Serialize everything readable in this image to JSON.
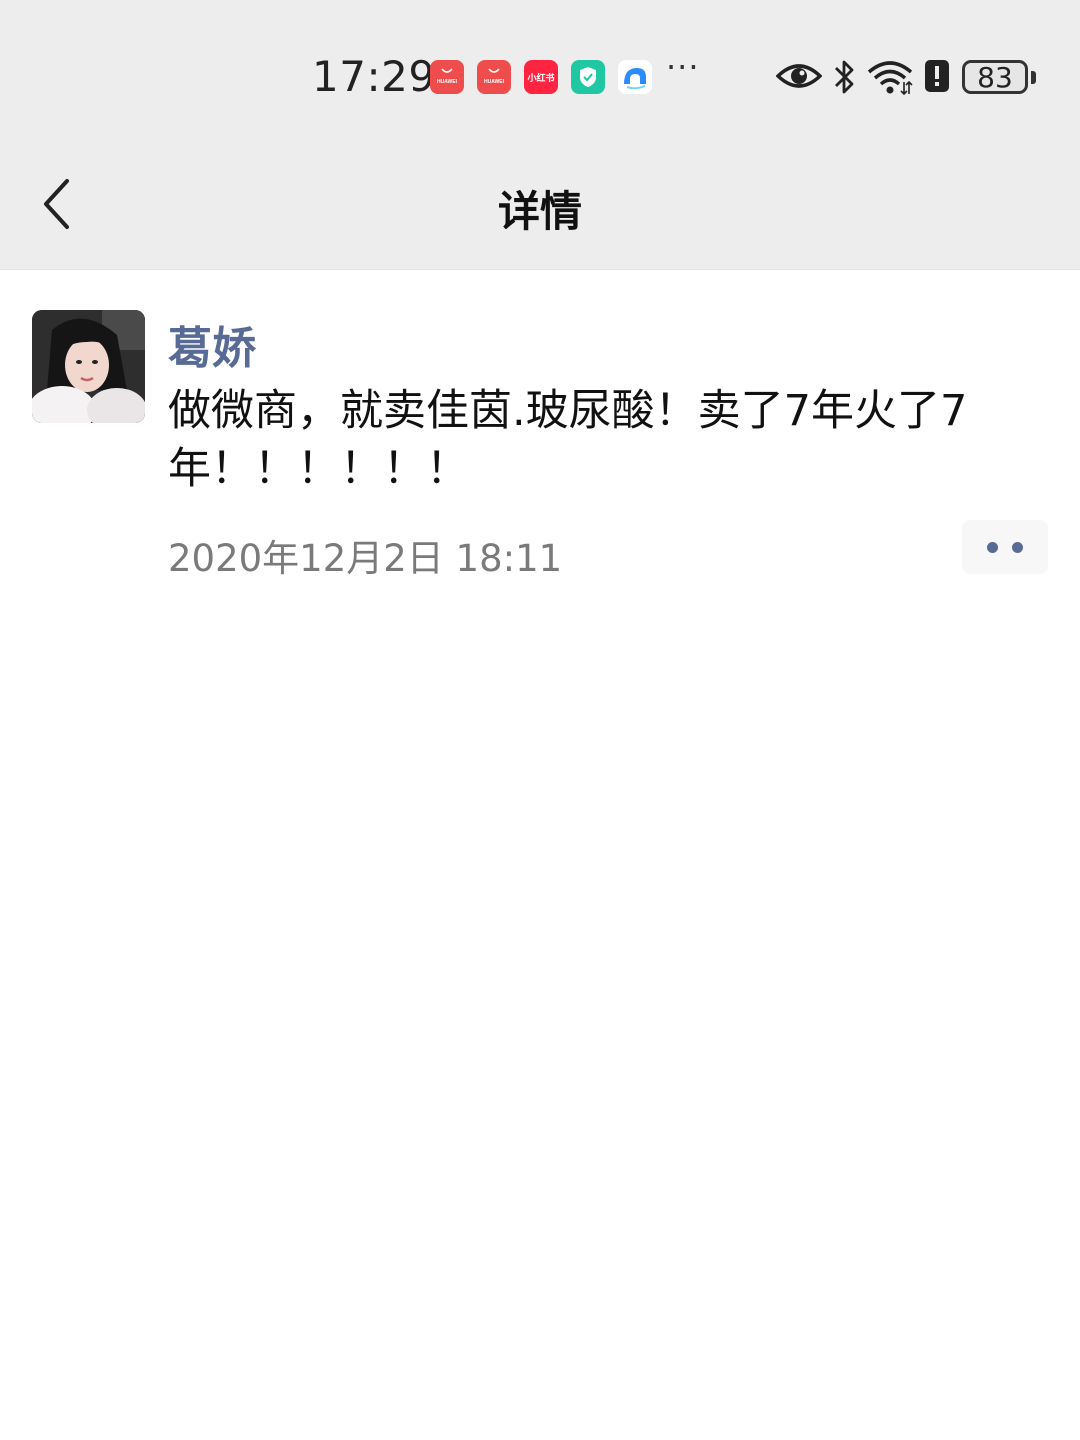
{
  "status_bar": {
    "time": "17:29",
    "app_icons": [
      {
        "name": "huawei-appgallery-icon",
        "label": "HUAWEI",
        "color": "#ef4d4d"
      },
      {
        "name": "huawei-appgallery-icon",
        "label": "HUAWEI",
        "color": "#ef4d4d"
      },
      {
        "name": "xiaohongshu-icon",
        "label": "小红书",
        "color": "#ff2442"
      },
      {
        "name": "security-shield-icon",
        "color": "#1fc7a3"
      },
      {
        "name": "browser-icon",
        "color": "#2b8cff"
      }
    ],
    "more": "···",
    "battery_level": "83"
  },
  "nav": {
    "title": "详情",
    "back_icon": "chevron-left-icon"
  },
  "post": {
    "author": "葛娇",
    "text": "做微商，就卖佳茵.玻尿酸！卖了7年火了7年！！！！！！",
    "time": "2020年12月2日 18:11",
    "more_icon": "two-dots-icon"
  },
  "colors": {
    "nav_bg": "#ededed",
    "author_link": "#576b95",
    "timestamp": "#7a7a7a"
  }
}
